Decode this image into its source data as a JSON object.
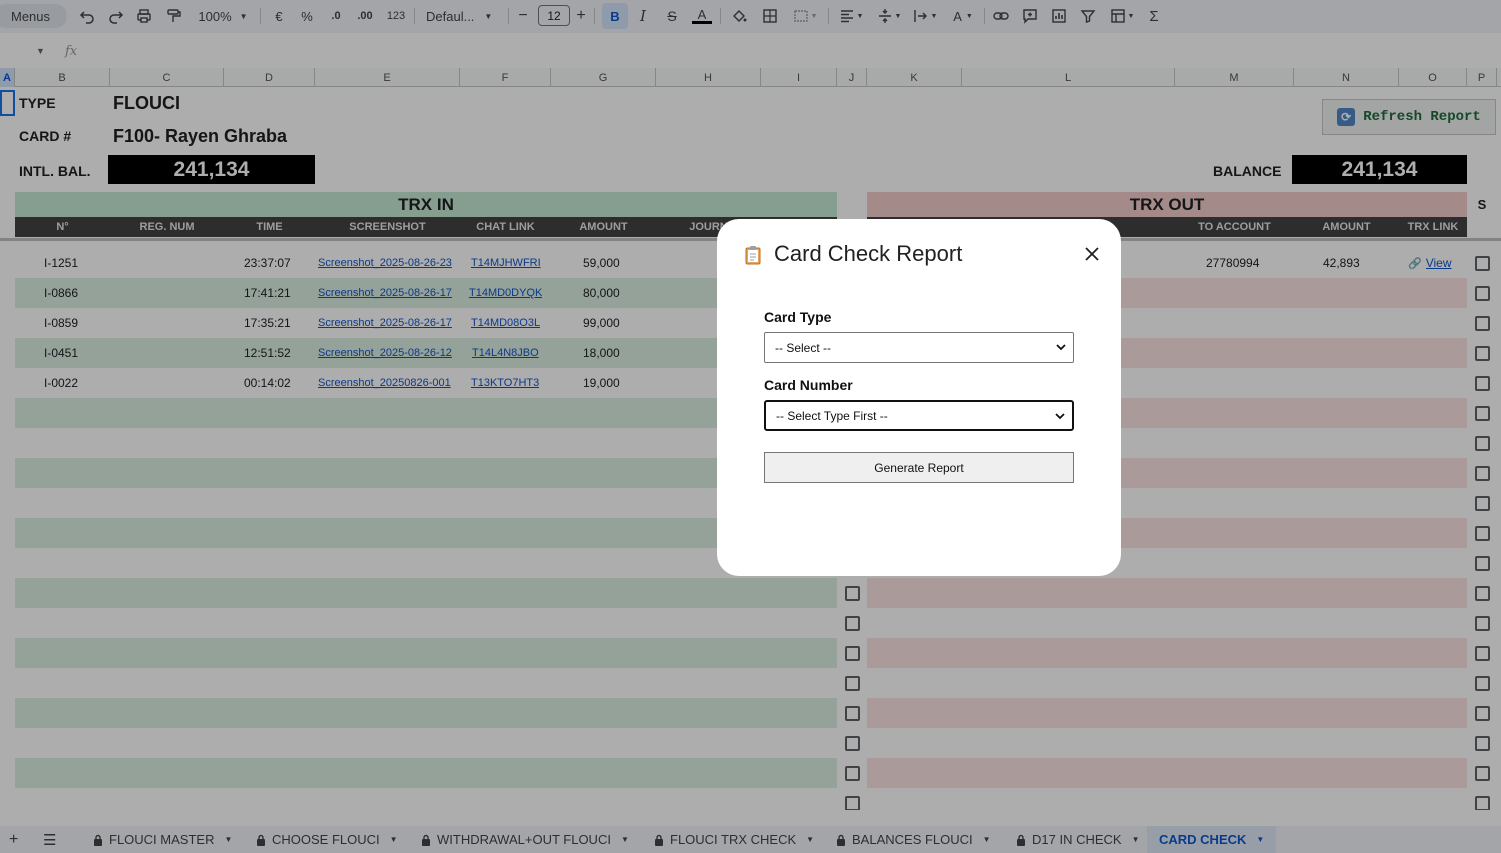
{
  "toolbar": {
    "menus_label": "Menus",
    "zoom": "100%",
    "currency": "€",
    "percent": "%",
    "decimal_decrease": ".0",
    "decimal_increase": ".00",
    "number_format": "123",
    "font_name": "Defaul...",
    "font_size": "12",
    "bold": "B",
    "sum": "Σ"
  },
  "formula_bar": {
    "fx": "fx"
  },
  "columns": [
    "A",
    "B",
    "C",
    "D",
    "E",
    "F",
    "G",
    "H",
    "I",
    "J",
    "K",
    "L",
    "M",
    "N",
    "O",
    "P"
  ],
  "header": {
    "type_label": "TYPE",
    "type_value": "FLOUCI",
    "card_label": "CARD #",
    "card_value": "F100- Rayen Ghraba",
    "intl_bal_label": "INTL. BAL.",
    "intl_bal_value": "241,134",
    "balance_label": "BALANCE",
    "balance_value": "241,134",
    "refresh_label": "Refresh Report"
  },
  "trx_in": {
    "title": "TRX IN",
    "columns": [
      "N°",
      "REG. NUM",
      "TIME",
      "SCREENSHOT",
      "CHAT LINK",
      "AMOUNT",
      "JOURN"
    ],
    "rows": [
      {
        "n": "I-1251",
        "time": "23:37:07",
        "screenshot": "Screenshot_2025-08-26-23",
        "chat": "T14MJHWFRI",
        "amount": "59,000"
      },
      {
        "n": "I-0866",
        "time": "17:41:21",
        "screenshot": "Screenshot_2025-08-26-17",
        "chat": "T14MD0DYQK",
        "amount": "80,000"
      },
      {
        "n": "I-0859",
        "time": "17:35:21",
        "screenshot": "Screenshot_2025-08-26-17",
        "chat": "T14MD08O3L",
        "amount": "99,000"
      },
      {
        "n": "I-0451",
        "time": "12:51:52",
        "screenshot": "Screenshot_2025-08-26-12",
        "chat": "T14L4N8JBO",
        "amount": "18,000"
      },
      {
        "n": "I-0022",
        "time": "00:14:02",
        "screenshot": "Screenshot_20250826-001",
        "chat": "T13KTO7HT3",
        "amount": "19,000"
      }
    ]
  },
  "trx_out": {
    "title": "TRX OUT",
    "columns": [
      "TO ACCOUNT",
      "AMOUNT",
      "TRX LINK"
    ],
    "rows": [
      {
        "to_account": "27780994",
        "amount": "42,893",
        "link": "View"
      }
    ]
  },
  "s_header": "S",
  "modal": {
    "title": "Card Check Report",
    "card_type_label": "Card Type",
    "card_type_value": "-- Select --",
    "card_number_label": "Card Number",
    "card_number_value": "-- Select Type First --",
    "generate_label": "Generate Report"
  },
  "tabs": [
    {
      "label": "FLOUCI MASTER",
      "locked": true
    },
    {
      "label": "CHOOSE FLOUCI",
      "locked": true
    },
    {
      "label": "WITHDRAWAL+OUT FLOUCI",
      "locked": true
    },
    {
      "label": "FLOUCI TRX CHECK",
      "locked": true
    },
    {
      "label": "BALANCES FLOUCI",
      "locked": true
    },
    {
      "label": "D17 IN CHECK",
      "locked": true
    },
    {
      "label": "CARD CHECK",
      "locked": false,
      "active": true
    }
  ]
}
